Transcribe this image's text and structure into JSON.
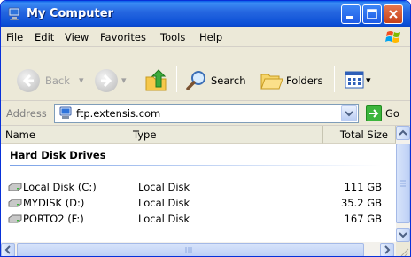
{
  "window": {
    "title": "My Computer",
    "icon": "my-computer-icon"
  },
  "menu": {
    "items": [
      "File",
      "Edit",
      "View",
      "Favorites",
      "Tools",
      "Help"
    ]
  },
  "toolbar": {
    "back_label": "Back",
    "search_label": "Search",
    "folders_label": "Folders"
  },
  "address": {
    "label": "Address",
    "value": "ftp.extensis.com",
    "go_label": "Go"
  },
  "list": {
    "columns": [
      "Name",
      "Type",
      "Total Size"
    ],
    "group_title": "Hard Disk Drives",
    "rows": [
      {
        "name": "Local Disk (C:)",
        "type": "Local Disk",
        "size": "111 GB"
      },
      {
        "name": "MYDISK (D:)",
        "type": "Local Disk",
        "size": "35.2 GB"
      },
      {
        "name": "PORTO2 (F:)",
        "type": "Local Disk",
        "size": "167 GB"
      }
    ]
  },
  "colors": {
    "titlebar": "#0A5FE8",
    "chrome": "#ECE9D8",
    "group_line": "#7BA2E7"
  }
}
